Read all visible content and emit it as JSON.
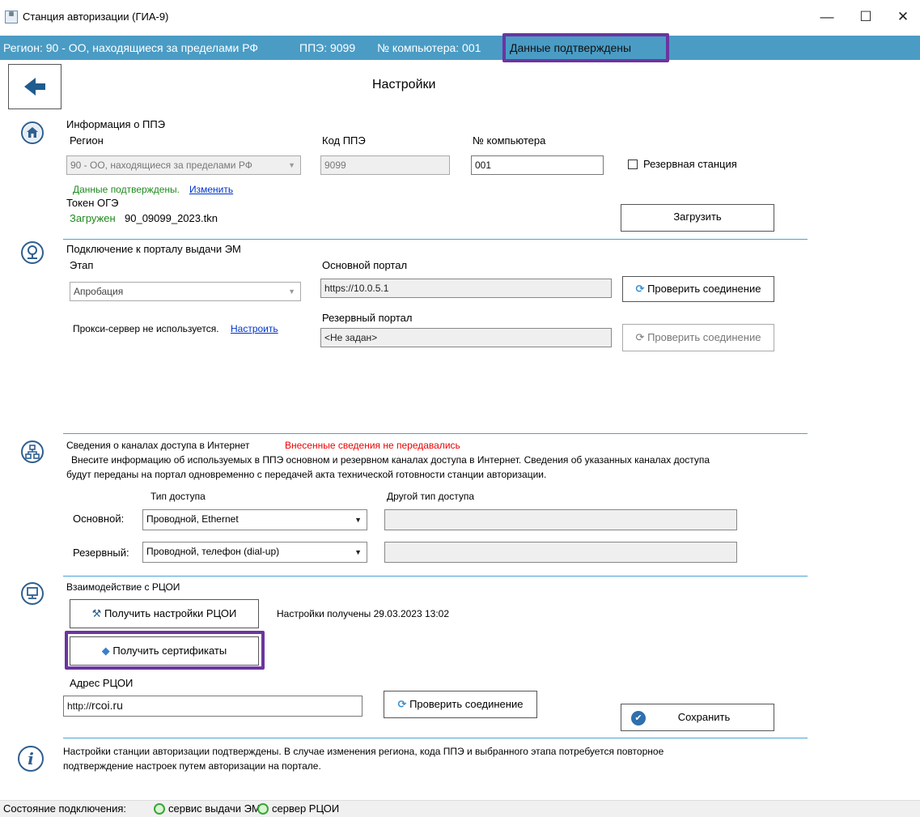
{
  "window": {
    "title": "Станция авторизации (ГИА-9)",
    "minimize": "—",
    "maximize": "☐",
    "close": "✕"
  },
  "infobar": {
    "region": "Регион: 90 - ОО, находящиеся за пределами РФ",
    "ppe": "ППЭ: 9099",
    "computer": "№ компьютера: 001",
    "status": "Данные подтверждены"
  },
  "page": {
    "title": "Настройки"
  },
  "ppe_info": {
    "heading": "Информация о ППЭ",
    "region_label": "Регион",
    "region_value": "90 - ОО, находящиеся за пределами РФ",
    "code_label": "Код ППЭ",
    "code_value": "9099",
    "computer_label": "№ компьютера",
    "computer_value": "001",
    "reserve_label": "Резервная станция",
    "confirmed_text": "Данные подтверждены.",
    "change_link": "Изменить",
    "token_label": "Токен ОГЭ",
    "token_status": "Загружен",
    "token_file": "90_09099_2023.tkn",
    "load_button": "Загрузить"
  },
  "portal": {
    "heading": "Подключение к порталу выдачи ЭМ",
    "stage_label": "Этап",
    "stage_value": "Апробация",
    "main_label": "Основной портал",
    "main_value": "https://10.0.5.1",
    "check_button": "Проверить соединение",
    "reserve_label": "Резервный портал",
    "reserve_value": "<Не задан>",
    "check_button_disabled": "Проверить соединение",
    "proxy_text": "Прокси-сервер не используется.",
    "proxy_link": "Настроить"
  },
  "channels": {
    "heading": "Сведения о каналах доступа в Интернет",
    "not_sent": "Внесенные сведения не передавались",
    "desc_line1": "Внесите информацию  об используемых в ППЭ основном и резервном каналах доступа в Интернет. Сведения об указанных каналах доступа",
    "desc_line2": "будут переданы на портал одновременно с передачей акта технической готовности станции авторизации.",
    "type_header": "Тип доступа",
    "other_header": "Другой тип доступа",
    "main_label": "Основной:",
    "main_value": "Проводной, Ethernet",
    "reserve_label": "Резервный:",
    "reserve_value": "Проводной, телефон (dial-up)"
  },
  "rcoi": {
    "heading": "Взаимодействие с РЦОИ",
    "get_settings_button": "Получить настройки РЦОИ",
    "settings_received": "Настройки получены 29.03.2023 13:02",
    "get_certs_button": "Получить сертификаты",
    "address_label": "Адрес РЦОИ",
    "address_prefix": "http://",
    "address_host": "rcoi.ru",
    "check_button": "Проверить соединение",
    "save_button": "Сохранить"
  },
  "note": {
    "line1": "Настройки станции авторизации подтверждены. В случае изменения региона, кода ППЭ и выбранного этапа потребуется повторное",
    "line2": "подтверждение настроек путем авторизации на портале."
  },
  "status": {
    "label": "Состояние подключения:",
    "service": "сервис выдачи ЭМ",
    "server": "сервер РЦОИ"
  },
  "colors": {
    "infobar": "#4a9cc5",
    "highlight": "#6b35a0",
    "separator": "#4aa3d6",
    "ok_green": "#1f8a1f",
    "error_red": "#e00000"
  }
}
